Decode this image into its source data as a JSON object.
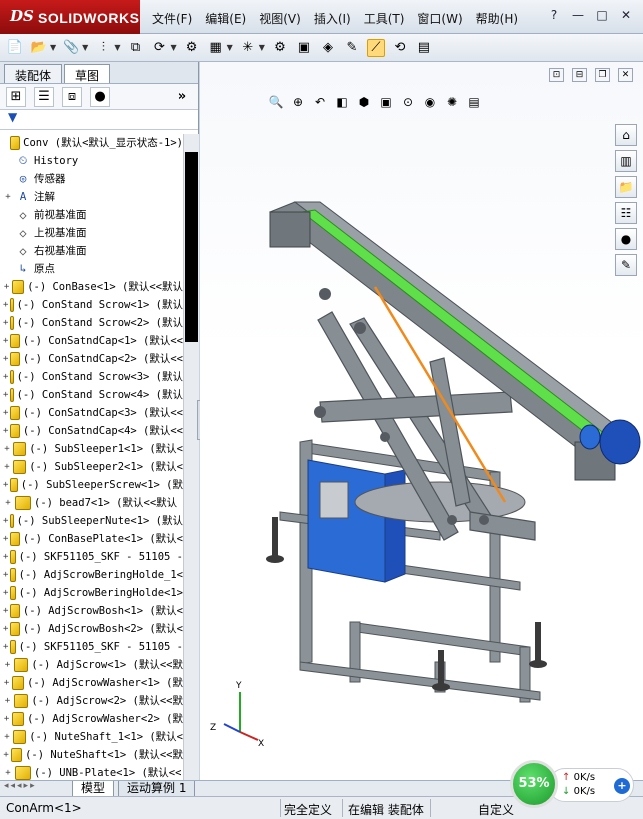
{
  "app": {
    "brand_ds": "DS",
    "brand_name": "SOLIDWORKS"
  },
  "menu": [
    "文件(F)",
    "编辑(E)",
    "视图(V)",
    "插入(I)",
    "工具(T)",
    "窗口(W)",
    "帮助(H)"
  ],
  "window_buttons": [
    "?",
    "—",
    "□",
    "✕"
  ],
  "left_panel": {
    "tabs": [
      "装配体",
      "草图"
    ],
    "active_tab": "草图",
    "more": "»",
    "filter": "▼"
  },
  "tree": {
    "root": "Conv  (默认<默认_显示状态-1>)",
    "fixed": [
      {
        "icon": "history-icon",
        "label": "History",
        "expand": ""
      },
      {
        "icon": "sensor-icon",
        "label": "传感器",
        "expand": ""
      },
      {
        "icon": "annotation-icon",
        "label": "注解",
        "expand": "+"
      },
      {
        "icon": "plane-icon",
        "label": "前视基准面",
        "expand": ""
      },
      {
        "icon": "plane-icon",
        "label": "上视基准面",
        "expand": ""
      },
      {
        "icon": "plane-icon",
        "label": "右视基准面",
        "expand": ""
      },
      {
        "icon": "origin-icon",
        "label": "原点",
        "expand": ""
      }
    ],
    "parts": [
      "(-) ConBase<1> (默认<<默认",
      "(-) ConStand Scrow<1> (默认",
      "(-) ConStand Scrow<2> (默认",
      "(-) ConSatndCap<1> (默认<<",
      "(-) ConSatndCap<2> (默认<<",
      "(-) ConStand Scrow<3> (默认",
      "(-) ConStand Scrow<4> (默认",
      "(-) ConSatndCap<3> (默认<<",
      "(-) ConSatndCap<4> (默认<<",
      "(-) SubSleeper1<1> (默认<",
      "(-) SubSleeper2<1> (默认<",
      "(-) SubSleeperScrew<1> (默",
      "(-) bead7<1> (默认<<默认",
      "(-) SubSleeperNute<1> (默认",
      "(-) ConBasePlate<1> (默认<",
      "(-) SKF51105_SKF - 51105 -",
      "(-) AdjScrowBeringHolde_1<",
      "(-) AdjScrowBeringHolde<1>",
      "(-) AdjScrowBosh<1> (默认<",
      "(-) AdjScrowBosh<2> (默认<",
      "(-) SKF51105_SKF - 51105 -",
      "(-) AdjScrow<1> (默认<<默",
      "(-) AdjScrowWasher<1> (默",
      "(-) AdjScrow<2> (默认<<默",
      "(-) AdjScrowWasher<2> (默",
      "(-) NuteShaft_1<1> (默认<",
      "(-) NuteShaft<1> (默认<<默",
      "(-) UNB-Plate<1> (默认<<"
    ]
  },
  "bottom_tabs": {
    "model": "模型",
    "motion": "运动算例 1"
  },
  "status": {
    "selection": "ConArm<1>",
    "defined": "完全定义",
    "editing": "在编辑 装配体",
    "custom": "自定义"
  },
  "network": {
    "percent": "53%",
    "up": "0K/s",
    "down": "0K/s"
  },
  "colors": {
    "accent_red": "#c71a1a",
    "belt_green": "#5fe04a",
    "frame_gray": "#7e868c",
    "motor_blue": "#1f4fb8",
    "cable_orange": "#f08a1c"
  }
}
